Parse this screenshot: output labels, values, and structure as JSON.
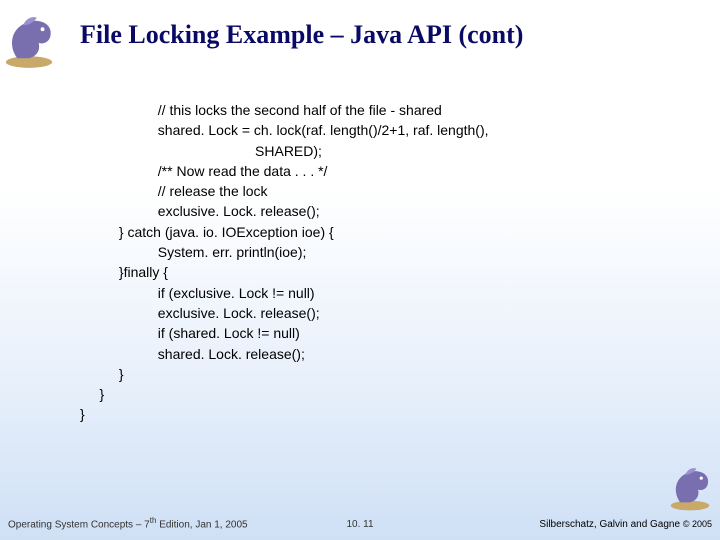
{
  "slide": {
    "title": "File Locking Example – Java API (cont)",
    "code_lines": {
      "l1": "                    // this locks the second half of the file - shared",
      "l2": "                    shared. Lock = ch. lock(raf. length()/2+1, raf. length(),",
      "l3": "                                             SHARED);",
      "l4": "                    /** Now read the data . . . */",
      "l5": "                    // release the lock",
      "l6": "                    exclusive. Lock. release();",
      "l7": "          } catch (java. io. IOException ioe) {",
      "l8": "                    System. err. println(ioe);",
      "l9": "          }finally {",
      "l10": "                    if (exclusive. Lock != null)",
      "l11": "                    exclusive. Lock. release();",
      "l12": "                    if (shared. Lock != null)",
      "l13": "                    shared. Lock. release();",
      "l14": "          }",
      "l15": "     }",
      "l16": "}"
    },
    "footer": {
      "left_prefix": "Operating System Concepts – 7",
      "left_sup": "th",
      "left_suffix": " Edition, Jan 1, 2005",
      "center": "10. 11",
      "right_name": "Silberschatz, Galvin and Gagne ",
      "right_copy": "© 2005"
    }
  }
}
